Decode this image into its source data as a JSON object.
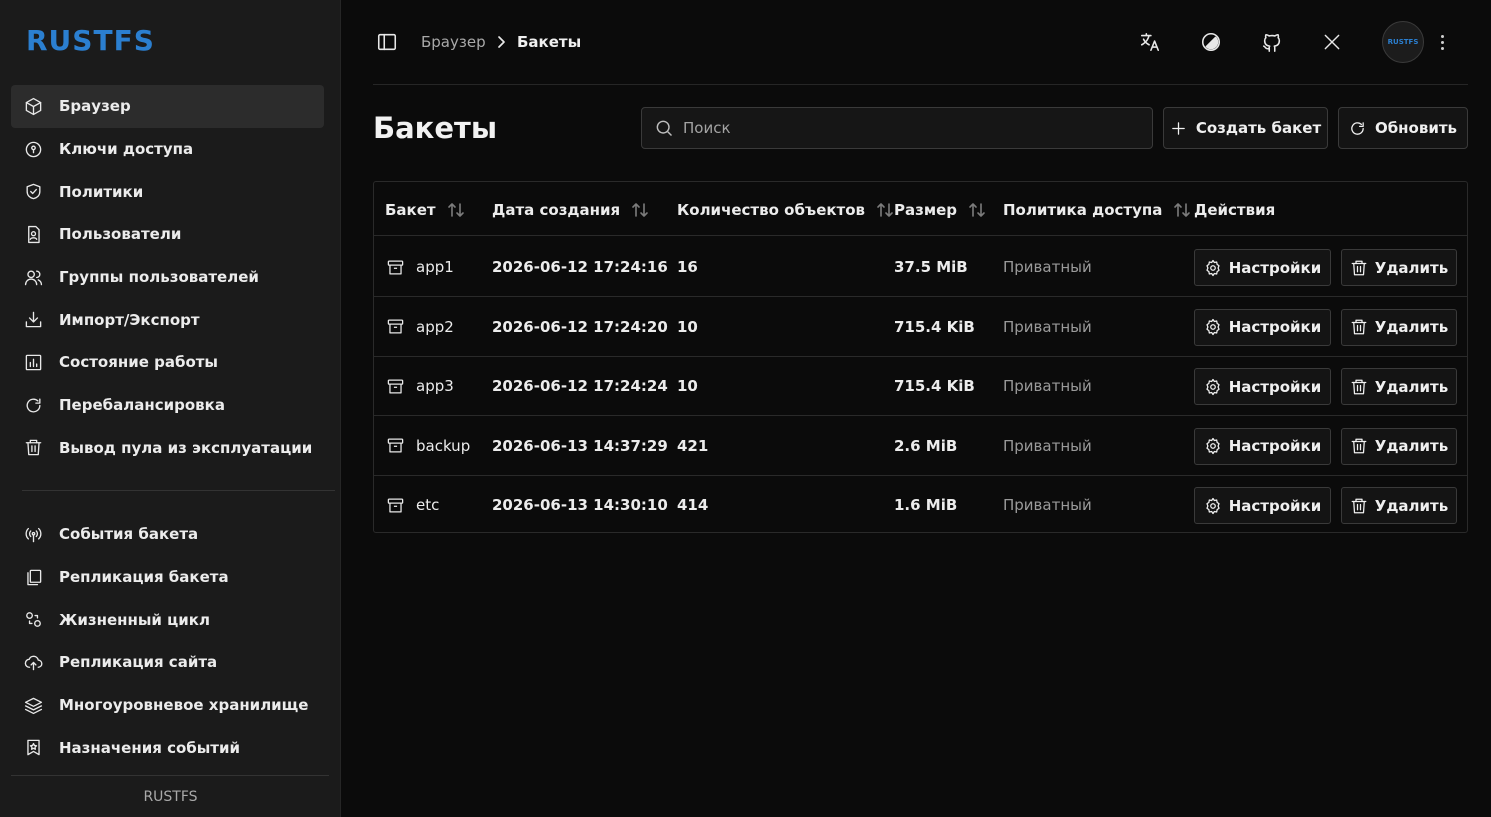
{
  "sidebar": {
    "logo": "RUSTFS",
    "items": [
      {
        "label": "Браузер",
        "icon": "box-icon",
        "active": true
      },
      {
        "label": "Ключи доступа",
        "icon": "key-circle-icon"
      },
      {
        "label": "Политики",
        "icon": "shield-check-icon"
      },
      {
        "label": "Пользователи",
        "icon": "user-file-icon"
      },
      {
        "label": "Группы пользователей",
        "icon": "users-icon"
      },
      {
        "label": "Импорт/Экспорт",
        "icon": "download-icon"
      },
      {
        "label": "Состояние работы",
        "icon": "bar-chart-icon"
      },
      {
        "label": "Перебалансировка",
        "icon": "refresh-icon"
      },
      {
        "label": "Вывод пула из эксплуатации",
        "icon": "trash-icon"
      }
    ],
    "items2": [
      {
        "label": "События бакета",
        "icon": "broadcast-icon"
      },
      {
        "label": "Репликация бакета",
        "icon": "copy-icon"
      },
      {
        "label": "Жизненный цикл",
        "icon": "lifecycle-icon"
      },
      {
        "label": "Репликация сайта",
        "icon": "cloud-upload-icon"
      },
      {
        "label": "Многоуровневое хранилище",
        "icon": "layers-icon"
      },
      {
        "label": "Назначения событий",
        "icon": "bookmark-star-icon"
      }
    ],
    "footer": "RUSTFS"
  },
  "topbar": {
    "breadcrumb": [
      "Браузер",
      "Бакеты"
    ],
    "avatar_text": "RUSTFS"
  },
  "page": {
    "title": "Бакеты",
    "search_placeholder": "Поиск",
    "create_label": "Создать бакет",
    "refresh_label": "Обновить"
  },
  "table": {
    "columns": [
      "Бакет",
      "Дата создания",
      "Количество объектов",
      "Размер",
      "Политика доступа",
      "Действия"
    ],
    "rows": [
      {
        "name": "app1",
        "created": "2026-06-12 17:24:16",
        "objects": "16",
        "size": "37.5 MiB",
        "policy": "Приватный"
      },
      {
        "name": "app2",
        "created": "2026-06-12 17:24:20",
        "objects": "10",
        "size": "715.4 KiB",
        "policy": "Приватный"
      },
      {
        "name": "app3",
        "created": "2026-06-12 17:24:24",
        "objects": "10",
        "size": "715.4 KiB",
        "policy": "Приватный"
      },
      {
        "name": "backup",
        "created": "2026-06-13 14:37:29",
        "objects": "421",
        "size": "2.6 MiB",
        "policy": "Приватный"
      },
      {
        "name": "etc",
        "created": "2026-06-13 14:30:10",
        "objects": "414",
        "size": "1.6 MiB",
        "policy": "Приватный"
      }
    ],
    "settings_label": "Настройки",
    "delete_label": "Удалить"
  },
  "colors": {
    "brand": "#2b7fd0",
    "background": "#0b0b0b",
    "sidebar": "#1b1b1b"
  }
}
